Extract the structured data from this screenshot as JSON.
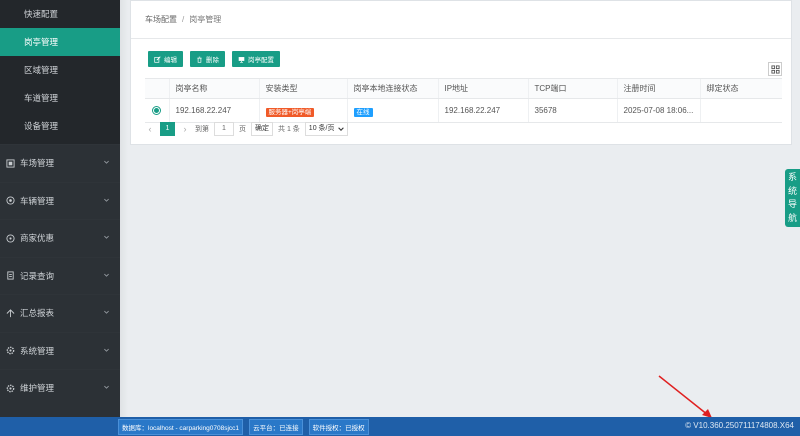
{
  "sidebar": {
    "sub_items": [
      {
        "label": "快速配置",
        "active": false
      },
      {
        "label": "岗亭管理",
        "active": true
      },
      {
        "label": "区域管理",
        "active": false
      },
      {
        "label": "车道管理",
        "active": false
      },
      {
        "label": "设备管理",
        "active": false
      }
    ],
    "groups": [
      {
        "label": "车场管理",
        "icon": "parking-icon"
      },
      {
        "label": "车辆管理",
        "icon": "car-icon"
      },
      {
        "label": "商家优惠",
        "icon": "discount-icon"
      },
      {
        "label": "记录查询",
        "icon": "record-icon"
      },
      {
        "label": "汇总报表",
        "icon": "report-icon"
      },
      {
        "label": "系统管理",
        "icon": "gear-icon"
      },
      {
        "label": "维护管理",
        "icon": "wrench-icon"
      }
    ]
  },
  "breadcrumb": {
    "parent": "车场配置",
    "separator": "/",
    "current": "岗亭管理"
  },
  "toolbar": {
    "edit": "编辑",
    "delete": "删除",
    "booth_config": "岗亭配置"
  },
  "table": {
    "headers": [
      "岗亭名称",
      "安装类型",
      "岗亭本地连接状态",
      "IP地址",
      "TCP端口",
      "注册时间",
      "绑定状态"
    ],
    "rows": [
      {
        "name": "192.168.22.247",
        "install_type": "服务器+岗亭端",
        "conn_status": "在线",
        "ip": "192.168.22.247",
        "port": "35678",
        "reg_time": "2025-07-08 18:06...",
        "bind_status": ""
      }
    ]
  },
  "pager": {
    "current": "1",
    "goto_prefix": "到第",
    "goto_value": "1",
    "goto_suffix": "页",
    "confirm": "确定",
    "total": "共 1 条",
    "page_size": "10 条/页"
  },
  "sysnav": {
    "chars": [
      "系",
      "统",
      "导",
      "航"
    ]
  },
  "status_bar": {
    "database": "数据库：localhost - carparking0708sjcc1",
    "cloud": "云平台：已连接",
    "license": "软件授权：已授权",
    "version": "© V10.360.250711174808.X64"
  },
  "colors": {
    "accent": "#189d86",
    "sidebar_bg": "#2c3136",
    "status_bar": "#1f5fa8",
    "tag_orange": "#f05a28",
    "tag_blue": "#1e9fff",
    "arrow": "#e02020"
  }
}
